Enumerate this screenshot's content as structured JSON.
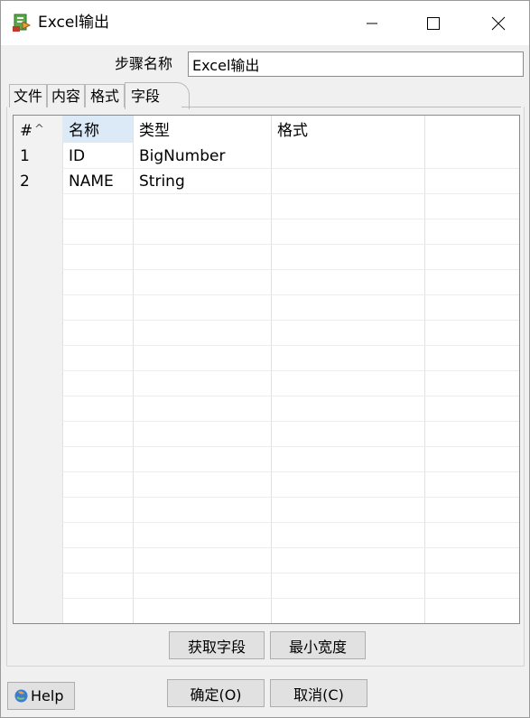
{
  "window": {
    "title": "Excel输出",
    "icons": {
      "app": "spoon-excel-output-icon",
      "minimize": "minimize-icon",
      "maximize": "maximize-icon",
      "close": "close-icon"
    }
  },
  "step": {
    "label": "步骤名称",
    "value": "Excel输出"
  },
  "tabs": [
    {
      "label": "文件"
    },
    {
      "label": "内容"
    },
    {
      "label": "格式"
    },
    {
      "label": "字段",
      "active": true
    }
  ],
  "grid": {
    "headers": {
      "index": "#",
      "name": "名称",
      "type": "类型",
      "format": "格式"
    },
    "sort_indicator": "^",
    "rows": [
      {
        "index": "1",
        "name": "ID",
        "type": "BigNumber",
        "format": ""
      },
      {
        "index": "2",
        "name": "NAME",
        "type": "String",
        "format": ""
      }
    ]
  },
  "buttons": {
    "get_fields": "获取字段",
    "min_width": "最小宽度",
    "ok": "确定(O)",
    "cancel": "取消(C)",
    "help": "Help"
  },
  "colors": {
    "accent_header": "#dce9f7",
    "window_bg": "#f0f0f0",
    "button_bg": "#e1e1e1"
  }
}
